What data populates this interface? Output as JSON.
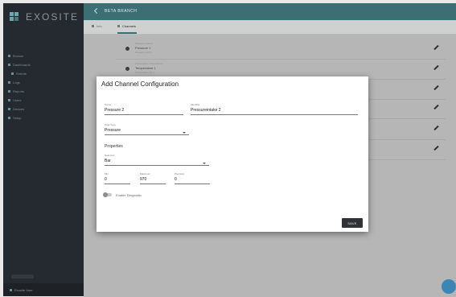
{
  "app": {
    "logo_text": "EXOSITE"
  },
  "topbar": {
    "title": "BETA BRANCH"
  },
  "sidebar": {
    "items": [
      {
        "label": "Browse",
        "sub": false
      },
      {
        "label": "Dashboards",
        "sub": false
      },
      {
        "label": "Robots",
        "sub": true
      },
      {
        "label": "Logs",
        "sub": false
      },
      {
        "label": "Reports",
        "sub": false
      },
      {
        "label": "Users",
        "sub": false
      },
      {
        "label": "Devices",
        "sub": false
      },
      {
        "label": "Setup",
        "sub": false
      }
    ],
    "user": "Exosite User"
  },
  "tabs": [
    {
      "label": "Info",
      "active": false
    },
    {
      "label": "Channels",
      "active": true
    }
  ],
  "list": [
    {
      "line1": "Pressure Sensor",
      "line2": "Pressure 1",
      "line3": "Pressure (psi) 1"
    },
    {
      "line1": "Temperature Temperature",
      "line2": "Temperature 1",
      "line3": "Temperature (F) 1"
    },
    {
      "line1": "",
      "line2": "",
      "line3": ""
    },
    {
      "line1": "",
      "line2": "",
      "line3": ""
    },
    {
      "line1": "",
      "line2": "",
      "line3": ""
    },
    {
      "line1": "",
      "line2": "",
      "line3": ""
    }
  ],
  "modal": {
    "title": "Add Channel Configuration",
    "name_label": "Name",
    "name_value": "Pressure 2",
    "identifier_label": "Identifier",
    "identifier_value": "Pressureintake 2",
    "data_type_label": "Data Type",
    "data_type_value": "Pressure",
    "properties_label": "Properties",
    "data_unit_label": "Data Unit",
    "data_unit_value": "Bar",
    "min_label": "Min",
    "min_value": "0",
    "max_label": "Maximum",
    "max_value": "970",
    "precision_label": "Precision",
    "precision_value": "0",
    "toggle_label": "Enable Diagnostic",
    "save_label": "SAVE"
  }
}
